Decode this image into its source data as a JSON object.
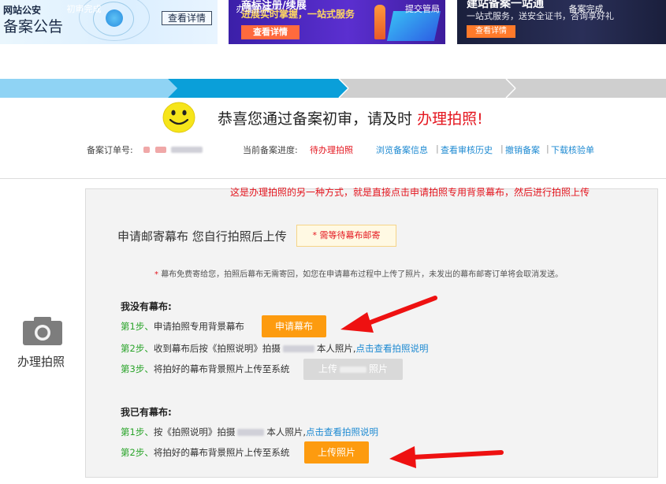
{
  "banners": {
    "b1": {
      "line1": "网站公安",
      "line2": "备案公告",
      "button": "查看详情"
    },
    "b2": {
      "line1": "商标注册/续展",
      "line2": "进展实时掌握，一站式服务",
      "button": "查看详情"
    },
    "b3": {
      "line1": "建站备案一站通",
      "line2": "一站式服务，送安全证书，咨询享好礼",
      "button": "查看详情"
    }
  },
  "steps": [
    {
      "label": "初审完成",
      "state": "done"
    },
    {
      "label": "办理拍照",
      "state": "active"
    },
    {
      "label": "提交管局",
      "state": "todo"
    },
    {
      "label": "备案完成",
      "state": "todo"
    }
  ],
  "status": {
    "congrats_prefix": "恭喜您通过备案初审，请及时",
    "congrats_highlight": "办理拍照!",
    "order_label": "备案订单号:",
    "progress_label": "当前备案进度:",
    "progress_value": "待办理拍照",
    "links": [
      "浏览备案信息",
      "查看审核历史",
      "撤销备案",
      "下载核验单"
    ],
    "sep": "|"
  },
  "annotation": "这是办理拍照的另一种方式，就是直接点击申请拍照专用背景幕布，然后进行拍照上传",
  "left_nav": {
    "label": "办理拍照",
    "icon": "camera-icon"
  },
  "mail": {
    "title": "申请邮寄幕布 您自行拍照后上传",
    "tag_star": "*",
    "tag": "需等待幕布邮寄",
    "notice_star": "*",
    "notice": "幕布免费寄给您，拍照后幕布无需寄回，如您在申请幕布过程中上传了照片，未发出的幕布邮寄订单将会取消发送。"
  },
  "no_screen": {
    "heading": "我没有幕布:",
    "step1_prefix": "第1步、",
    "step1_text": "申请拍照专用背景幕布",
    "step1_button": "申请幕布",
    "step2_prefix": "第2步、",
    "step2_text_a": "收到幕布后按《拍照说明》拍摄",
    "step2_text_b": "本人照片,",
    "step2_link": "点击查看拍照说明",
    "step3_prefix": "第3步、",
    "step3_text": "将拍好的幕布背景照片上传至系统",
    "step3_button_a": "上传",
    "step3_button_b": "照片"
  },
  "has_screen": {
    "heading": "我已有幕布:",
    "step1_prefix": "第1步、",
    "step1_text_a": "按《拍照说明》拍摄",
    "step1_text_b": "本人照片,",
    "step1_link": "点击查看拍照说明",
    "step2_prefix": "第2步、",
    "step2_text": "将拍好的幕布背景照片上传至系统",
    "step2_button": "上传照片"
  },
  "colors": {
    "step_done": "#8fd3f4",
    "step_active": "#0a9fd9",
    "step_todo": "#cccccc",
    "highlight_red": "#e4161f",
    "link_blue": "#1e8ad2",
    "step_green": "#2aa42a",
    "button_orange": "#fd9b0f",
    "button_disabled": "#d9d9d9",
    "arrow_red": "#ee1111"
  }
}
